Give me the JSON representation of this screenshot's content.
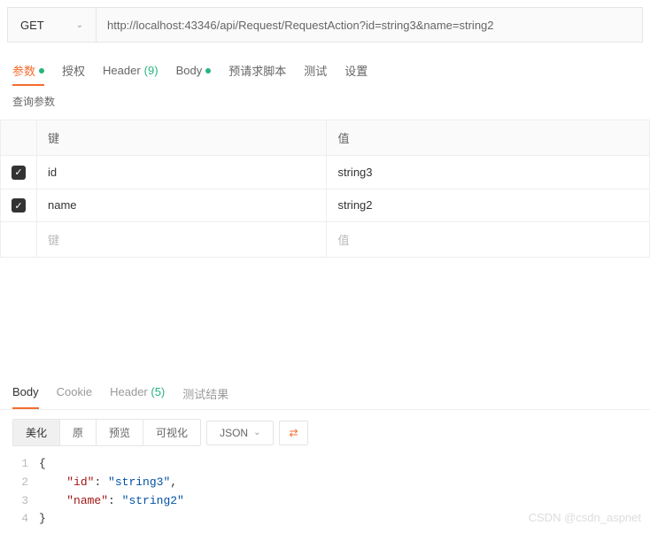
{
  "urlbar": {
    "method": "GET",
    "url": "http://localhost:43346/api/Request/RequestAction?id=string3&name=string2"
  },
  "tabs": {
    "params": "参数",
    "auth": "授权",
    "header": "Header",
    "header_count": "(9)",
    "body": "Body",
    "prerequest": "预请求脚本",
    "tests": "测试",
    "settings": "设置"
  },
  "subsection": {
    "query_params": "查询参数"
  },
  "table": {
    "key_header": "键",
    "value_header": "值",
    "key_placeholder": "键",
    "value_placeholder": "值",
    "rows": [
      {
        "key": "id",
        "value": "string3"
      },
      {
        "key": "name",
        "value": "string2"
      }
    ]
  },
  "resp_tabs": {
    "body": "Body",
    "cookie": "Cookie",
    "header": "Header",
    "header_count": "(5)",
    "results": "测试结果"
  },
  "toolbar": {
    "pretty": "美化",
    "raw": "原",
    "preview": "预览",
    "visual": "可视化",
    "format": "JSON"
  },
  "response": {
    "lines": [
      "1",
      "2",
      "3",
      "4"
    ],
    "open": "{",
    "close": "}",
    "indent1_key": "\"id\"",
    "indent1_val": "\"string3\"",
    "indent2_key": "\"name\"",
    "indent2_val": "\"string2\""
  },
  "watermark": "CSDN @csdn_aspnet"
}
